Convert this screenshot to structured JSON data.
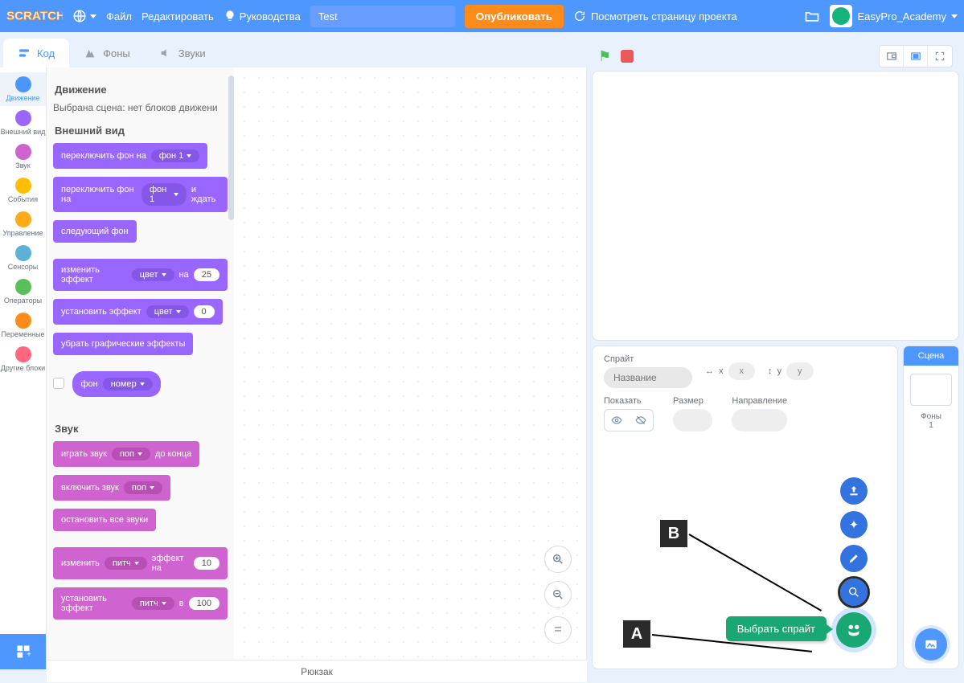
{
  "menubar": {
    "file": "Файл",
    "edit": "Редактировать",
    "tutorials": "Руководства",
    "project_title": "Test",
    "share": "Опубликовать",
    "see_project": "Посмотреть страницу проекта",
    "username": "EasyPro_Academy"
  },
  "tabs": {
    "code": "Код",
    "costumes": "Фоны",
    "sounds": "Звуки"
  },
  "categories": [
    {
      "id": "motion",
      "label": "Движение",
      "color": "#4c97ff",
      "active": true
    },
    {
      "id": "looks",
      "label": "Внешний вид",
      "color": "#9966ff"
    },
    {
      "id": "sound",
      "label": "Звук",
      "color": "#cf63cf"
    },
    {
      "id": "events",
      "label": "События",
      "color": "#ffbf00"
    },
    {
      "id": "control",
      "label": "Управление",
      "color": "#ffab19"
    },
    {
      "id": "sensing",
      "label": "Сенсоры",
      "color": "#5cb1d6"
    },
    {
      "id": "operators",
      "label": "Операторы",
      "color": "#59c059"
    },
    {
      "id": "variables",
      "label": "Переменные",
      "color": "#ff8c1a"
    },
    {
      "id": "myblocks",
      "label": "Другие блоки",
      "color": "#ff6680"
    }
  ],
  "palette": {
    "motion_h": "Движение",
    "motion_note": "Выбрана сцена: нет блоков движени",
    "looks_h": "Внешний вид",
    "b_switch_bg": "переключить фон на",
    "b_switch_bg_wait_a": "переключить фон на",
    "b_switch_bg_wait_b": "и ждать",
    "b_next_bg": "следующий фон",
    "b_change_effect_a": "изменить эффект",
    "b_change_effect_b": "на",
    "b_change_effect_val": "25",
    "b_set_effect": "установить эффект",
    "b_set_effect_val": "0",
    "b_clear_effects": "убрать графические эффекты",
    "b_bg_name": "фон",
    "b_bg_name_dd": "номер",
    "dd_bg": "фон 1",
    "dd_color": "цвет",
    "sound_h": "Звук",
    "b_play_until_a": "играть звук",
    "b_play_until_b": "до конца",
    "b_start_sound": "включить звук",
    "b_stop_sounds": "остановить все звуки",
    "b_change_pitch_a": "изменить",
    "b_change_pitch_b": "эффект на",
    "b_change_pitch_val": "10",
    "b_set_pitch_a": "установить эффект",
    "b_set_pitch_b": "в",
    "b_set_pitch_val": "100",
    "dd_pop": "поп",
    "dd_pitch": "питч"
  },
  "backpack": "Рюкзак",
  "sprite_info": {
    "label_sprite": "Спрайт",
    "name_ph": "Название",
    "x": "x",
    "y": "y",
    "show": "Показать",
    "size": "Размер",
    "direction": "Направление"
  },
  "stage_panel": {
    "header": "Сцена",
    "backdrops_label": "Фоны",
    "backdrops_count": "1"
  },
  "tooltip_choose_sprite": "Выбрать спрайт",
  "annotations": {
    "a": "A",
    "b": "B"
  }
}
